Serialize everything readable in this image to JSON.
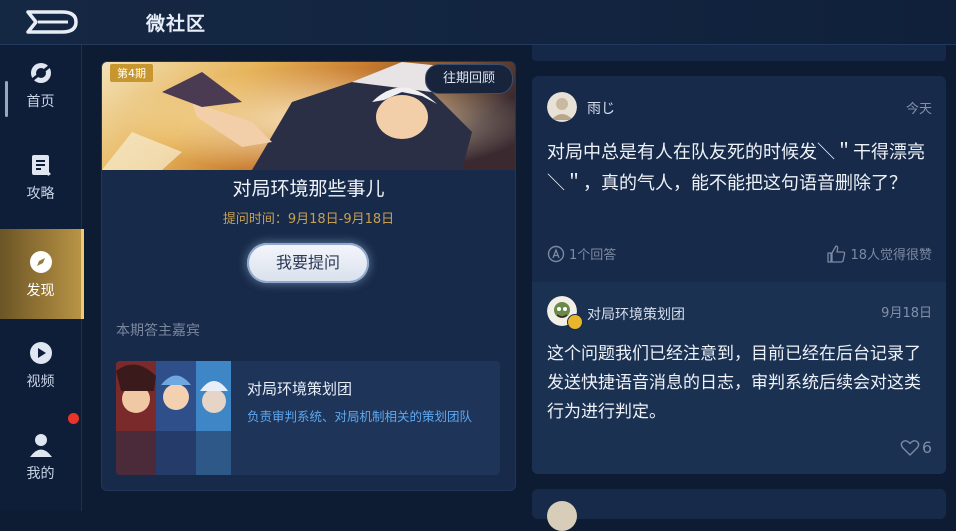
{
  "header": {
    "title": "微社区",
    "back_icon": "back-arrow-icon"
  },
  "sidebar": {
    "items": [
      {
        "label": "首页",
        "icon": "home-icon"
      },
      {
        "label": "攻略",
        "icon": "guide-icon"
      },
      {
        "label": "发现",
        "icon": "discover-compass-icon",
        "active": true
      },
      {
        "label": "视频",
        "icon": "play-icon"
      },
      {
        "label": "我的",
        "icon": "profile-icon"
      }
    ]
  },
  "topic": {
    "issue_badge": "第4期",
    "past_button": "往期回顾",
    "title": "对局环境那些事儿",
    "time": "提问时间：9月18日-9月18日",
    "ask_button": "我要提问",
    "guest_heading": "本期答主嘉宾",
    "guest": {
      "name": "对局环境策划团",
      "description": "负责审判系统、对局机制相关的策划团队"
    }
  },
  "post": {
    "author": "雨じ",
    "date": "今天",
    "question": "对局中总是有人在队友死的时候发＼＂干得漂亮＼＂，真的气人，能不能把这句语音删除了？",
    "answers": "1个回答",
    "likes": "18人觉得很赞",
    "answer": {
      "author": "对局环境策划团",
      "date": "9月18日",
      "text": "这个问题我们已经注意到，目前已经在后台记录了发送快捷语音消息的日志，审判系统后续会对这类行为进行判定。",
      "like_count": "6"
    }
  },
  "colors": {
    "accent": "#c8a050",
    "active_tab": "#9a7a38",
    "link": "#5ea8ee",
    "notification": "#e8352b"
  }
}
